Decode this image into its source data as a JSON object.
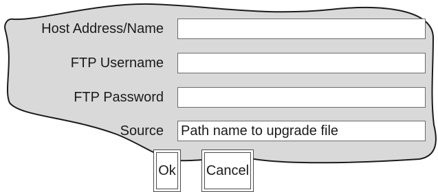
{
  "form": {
    "host": {
      "label": "Host Address/Name",
      "value": ""
    },
    "username": {
      "label": "FTP Username",
      "value": ""
    },
    "password": {
      "label": "FTP Password",
      "value": ""
    },
    "source": {
      "label": "Source",
      "placeholder": "Path name to upgrade file",
      "value": ""
    }
  },
  "buttons": {
    "ok_label": "Ok",
    "cancel_label": "Cancel"
  }
}
